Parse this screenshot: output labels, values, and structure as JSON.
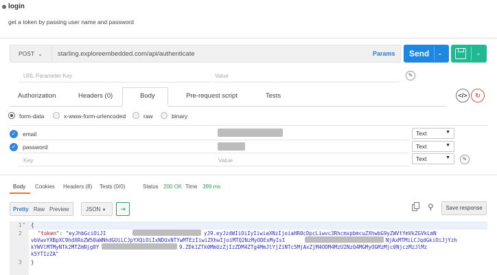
{
  "header": {
    "title": "login",
    "description": "get a token by passing user name and password"
  },
  "request": {
    "method": "POST",
    "url": "starling.exploreembedded.com/api/authenticate",
    "params_label": "Params",
    "send_label": "Send",
    "url_param_key_placeholder": "URL Parameter Key",
    "url_param_value_placeholder": "Value"
  },
  "tabs": [
    "Authorization",
    "Headers (0)",
    "Body",
    "Pre-request script",
    "Tests"
  ],
  "body_modes": [
    "form-data",
    "x-www-form-urlencoded",
    "raw",
    "binary"
  ],
  "form_rows": [
    {
      "key": "email",
      "type": "Text"
    },
    {
      "key": "password",
      "type": "Text"
    }
  ],
  "form_new_row": {
    "key_placeholder": "Key",
    "value_placeholder": "Value",
    "type": "Text"
  },
  "response": {
    "tabs": [
      "Body",
      "Cookies",
      "Headers (8)",
      "Tests (0/0)"
    ],
    "status_label": "Status",
    "status_value": "200 OK",
    "time_label": "Time",
    "time_value": "399 ms",
    "formats": [
      "Pretty",
      "Raw",
      "Preview"
    ],
    "language": "JSON",
    "save_label": "Save response",
    "line_numbers": [
      "1",
      "2",
      "3"
    ],
    "code_open": "{",
    "code_key": "\"token\"",
    "code_colon": ": ",
    "code_l2a": "\"eyJhbGciOiJI",
    "code_l2b": "yJ9.eyJzdWIiOiIyIiwiaXNzIjoiaHR0cDpcLiwvc3RhcmxpbmcuZXhwbG9yZWVtYmVkZGVkLmN",
    "code_l3a": "vbVwvYXBpXC9hdXRoZW50aWNhdGUiLCJpYXQiOiIxNDUxNTYwMTEzIiwiZXhwIjoiMTQ2NzMyODExMyIsI",
    "code_l3b": "NjAxMTMiLCJqdGkiOiJjYzh",
    "code_l4a": "kYWVlMTMyNTk2MTZmNjg0Y",
    "code_l4b": "9.ZDk1ZTk0MmUzZjIzZDM4ZTg4MmJlYjZiNTc5MjAxZjM4ODM4MzU2NzQ4MGMyOGMzMjc0NjczMzJlMz",
    "code_l5": "k5YTIzZA\"",
    "code_close": "}"
  }
}
